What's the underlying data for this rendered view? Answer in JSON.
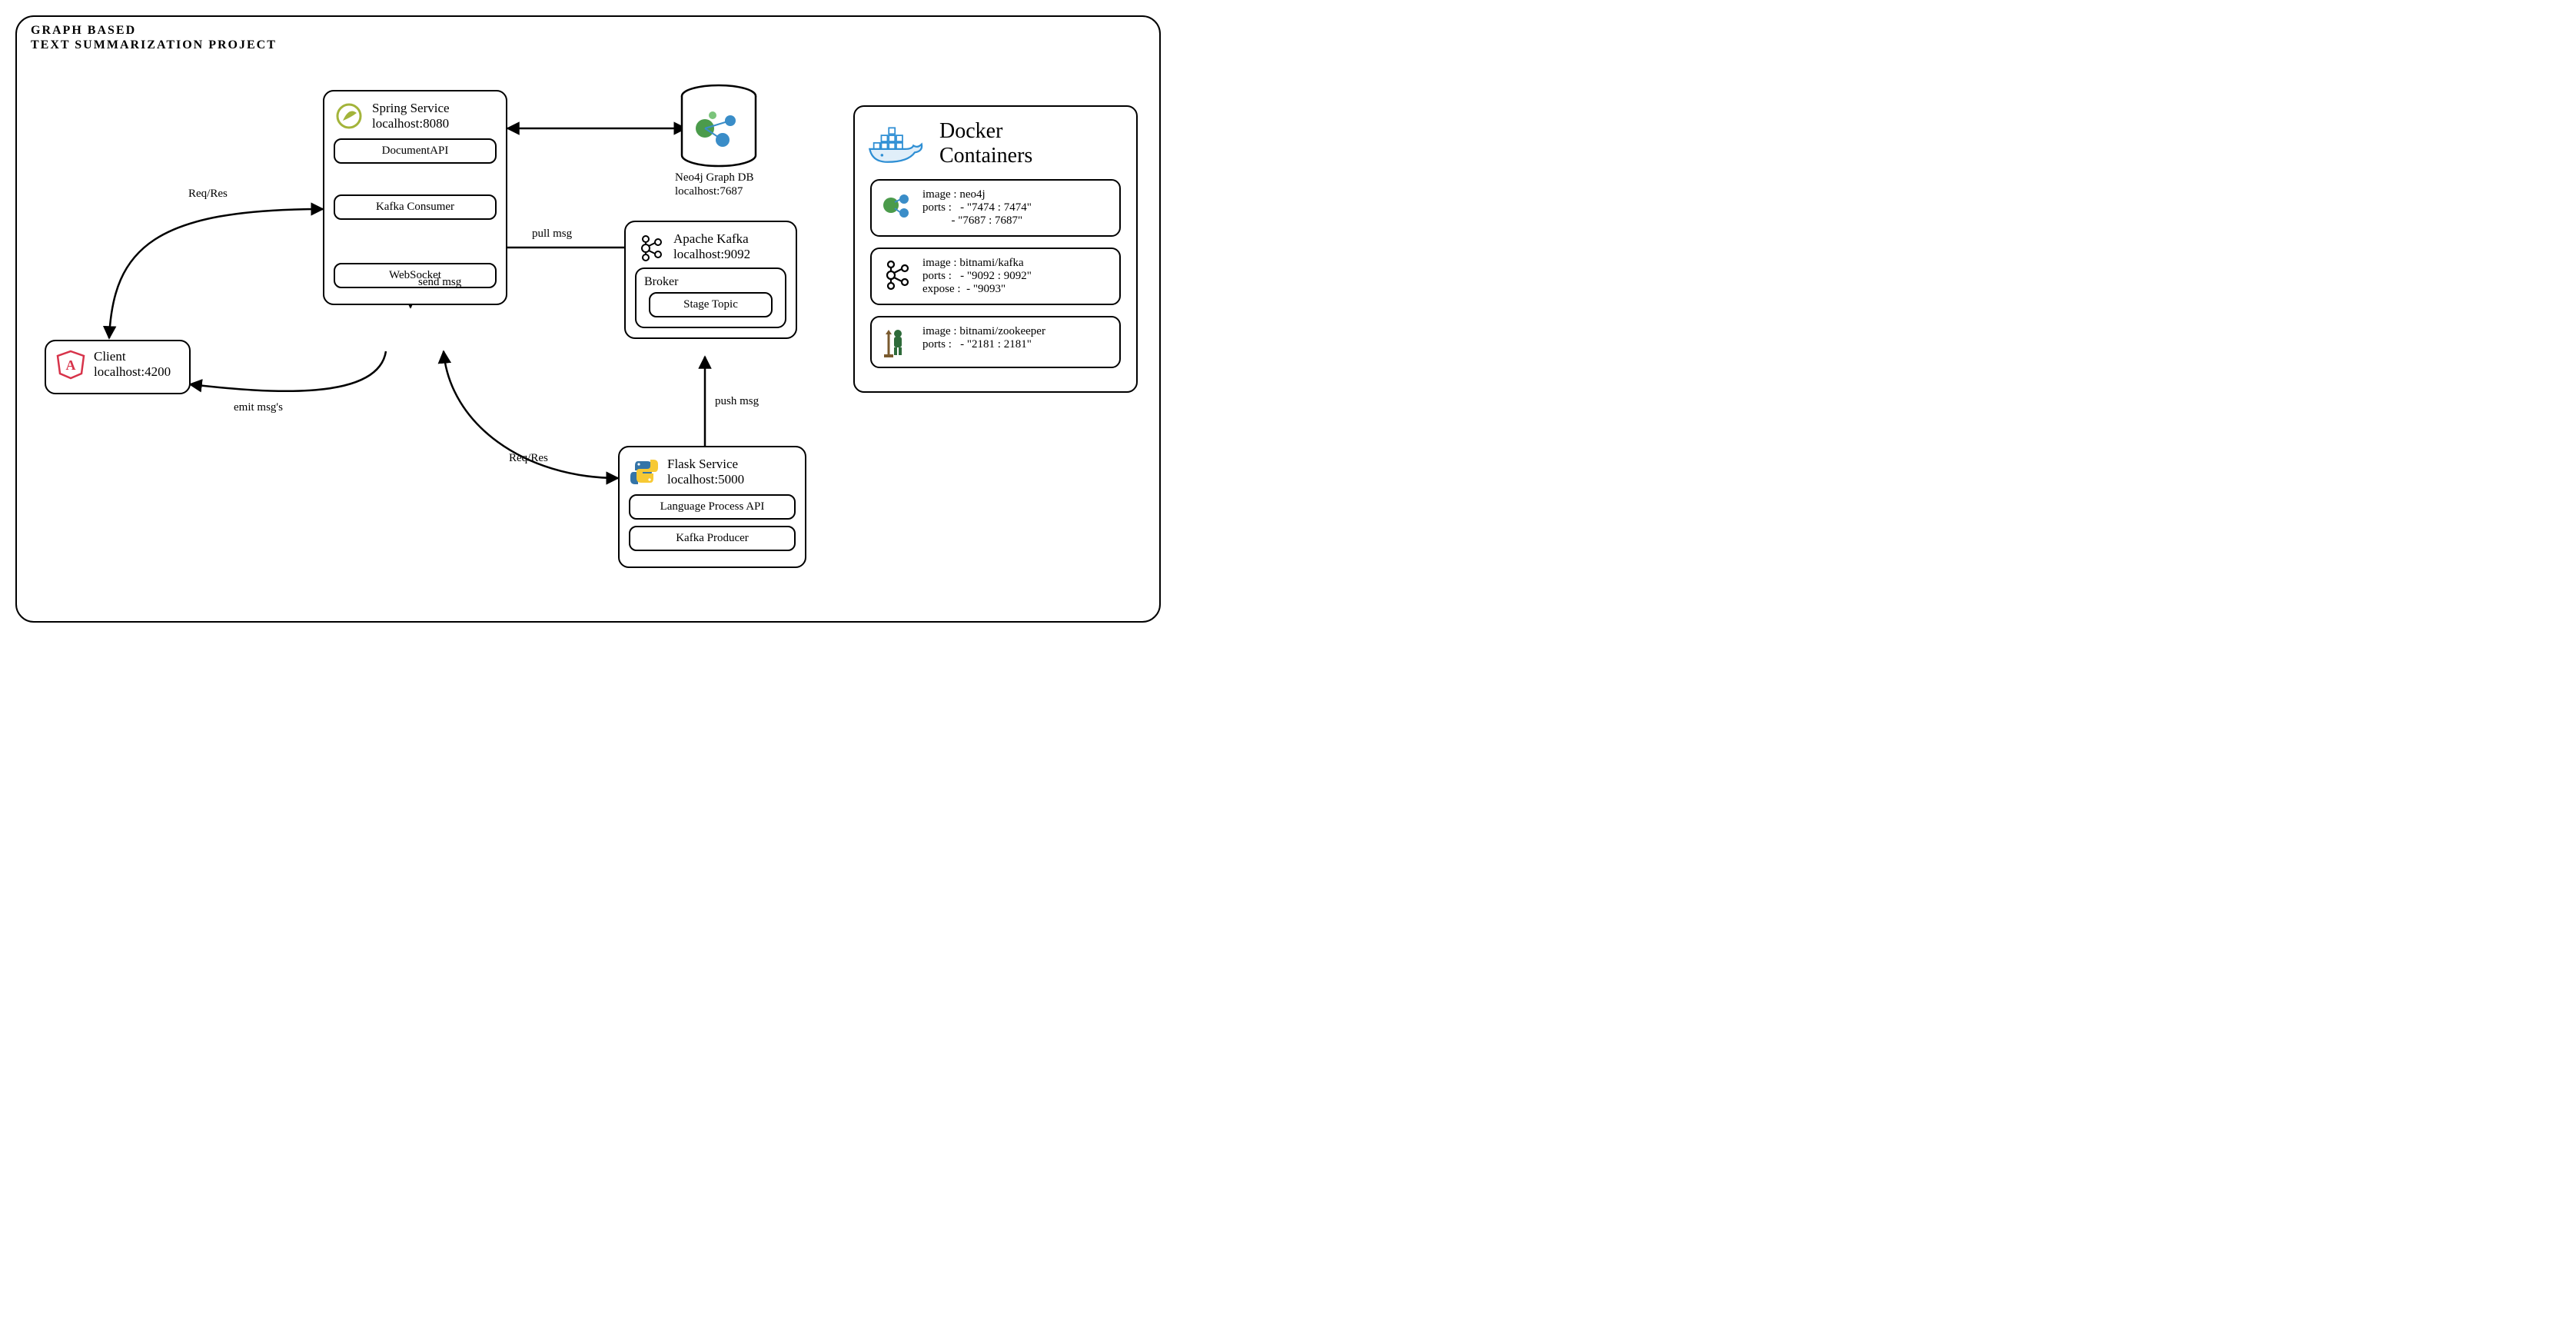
{
  "title_line1": "GRAPH BASED",
  "title_line2": "TEXT SUMMARIZATION PROJECT",
  "client": {
    "name": "Client",
    "addr": "localhost:4200"
  },
  "spring": {
    "name": "Spring Service",
    "addr": "localhost:8080",
    "document_api": "DocumentAPI",
    "kafka_consumer": "Kafka Consumer",
    "websocket": "WebSocket"
  },
  "neo4j": {
    "name": "Neo4j Graph DB",
    "addr": "localhost:7687"
  },
  "kafka": {
    "name": "Apache Kafka",
    "addr": "localhost:9092",
    "broker": "Broker",
    "stage_topic": "Stage Topic"
  },
  "flask": {
    "name": "Flask Service",
    "addr": "localhost:5000",
    "lang_api": "Language Process API",
    "producer": "Kafka Producer"
  },
  "docker": {
    "title": "Docker Containers",
    "neo4j": "image : neo4j\nports :   - \"7474 : 7474\"\n          - \"7687 : 7687\"",
    "kafka": "image : bitnami/kafka\nports :   - \"9092 : 9092\"\nexpose :  - \"9093\"",
    "zookeeper": "image : bitnami/zookeeper\nports :   - \"2181 : 2181\""
  },
  "edges": {
    "req_res_top": "Req/Res",
    "emit_msgs": "emit msg's",
    "send_msg": "send msg",
    "pull_msg": "pull msg",
    "push_msg": "push msg",
    "req_res_bottom": "Req/Res"
  }
}
